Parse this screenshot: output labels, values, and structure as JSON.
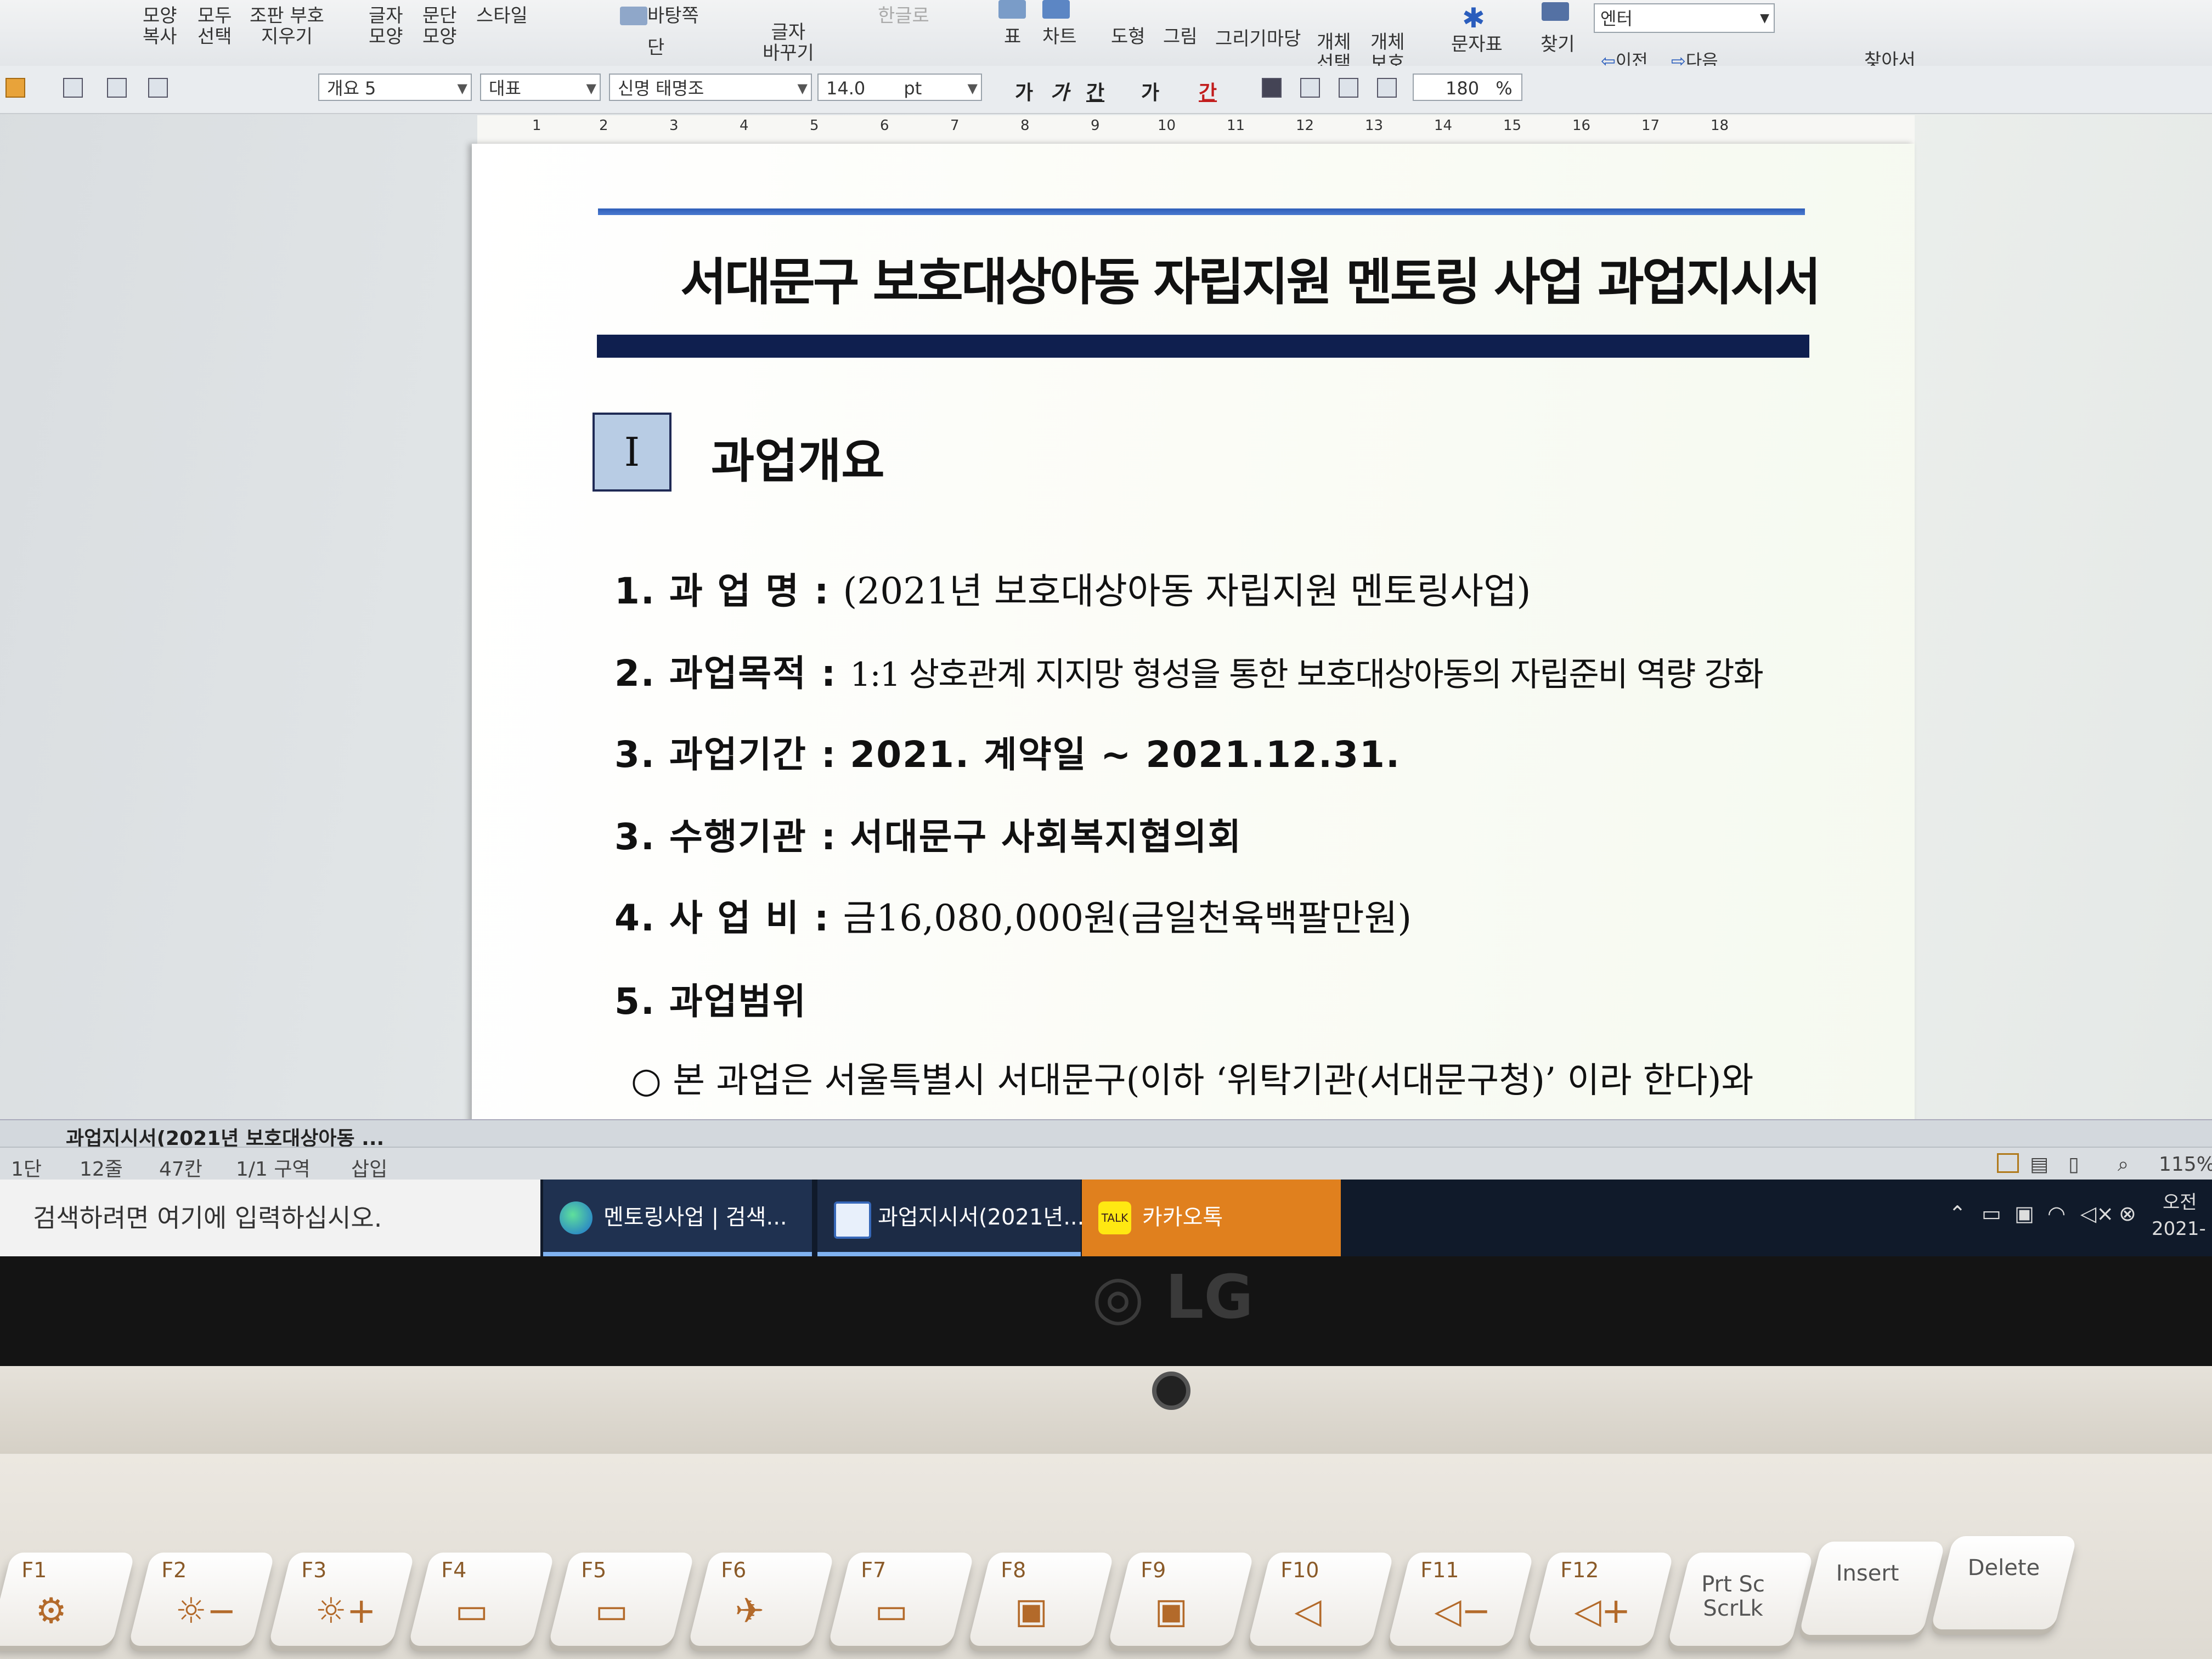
{
  "ribbon": {
    "items": [
      {
        "label": "모양\n복사"
      },
      {
        "label": "모두\n선택"
      },
      {
        "label": "조판 부호\n지우기"
      },
      {
        "label": "글자\n모양"
      },
      {
        "label": "문단\n모양"
      },
      {
        "label": "스타일"
      },
      {
        "label": "바탕쪽"
      },
      {
        "label": "단"
      },
      {
        "label": "글자\n바꾸기"
      },
      {
        "label": "한글로"
      },
      {
        "label": "표"
      },
      {
        "label": "차트"
      },
      {
        "label": "도형"
      },
      {
        "label": "그림"
      },
      {
        "label": "그리기마당"
      },
      {
        "label": "개체\n선택"
      },
      {
        "label": "개체\n보호"
      },
      {
        "label": "문자표"
      },
      {
        "label": "찾기"
      },
      {
        "label": "이전"
      },
      {
        "label": "다음"
      },
      {
        "label": "찾아서\n바꾸기"
      }
    ],
    "search_value": "엔터"
  },
  "format_bar": {
    "style": "개요 5",
    "lang": "대표",
    "font": "신명 태명조",
    "size": "14.0",
    "unit": "pt",
    "bold": "가",
    "italic": "가",
    "underline": "간",
    "strike": "가",
    "color": "간",
    "line_spacing": "180",
    "line_spacing_unit": "%"
  },
  "ruler": {
    "marks": [
      "1",
      "2",
      "3",
      "4",
      "5",
      "6",
      "7",
      "8",
      "9",
      "10",
      "11",
      "12",
      "13",
      "14",
      "15",
      "16",
      "17",
      "18"
    ]
  },
  "document": {
    "title": "서대문구 보호대상아동 자립지원 멘토링 사업 과업지시서",
    "section_num": "I",
    "section_title": "과업개요",
    "rows": [
      {
        "label": "1. 과 업 명",
        "sep": ":",
        "value": "(2021년 보호대상아동 자립지원 멘토링사업)"
      },
      {
        "label": "2. 과업목적",
        "sep": ":",
        "value": "1:1 상호관계 지지망 형성을 통한 보호대상아동의 자립준비 역량 강화"
      },
      {
        "label": "3. 과업기간",
        "sep": ":",
        "value": "2021. 계약일 ~ 2021.12.31."
      },
      {
        "label": "3. 수행기관",
        "sep": ":",
        "value": "서대문구 사회복지협의회"
      },
      {
        "label": "4. 사 업 비",
        "sep": ":",
        "value": "금16,080,000원(금일천육백팔만원)"
      },
      {
        "label": "5. 과업범위",
        "sep": "",
        "value": ""
      }
    ],
    "bullet": "○ 본 과업은 서울특별시 서대문구(이하 ‘위탁기관(서대문구청)’ 이라 한다)와"
  },
  "doc_tab": {
    "label": "과업지시서(2021년 보호대상아동 ..."
  },
  "status": {
    "col": "1단",
    "line": "12줄",
    "char": "47칸",
    "section": "1/1 구역",
    "mode": "삽입",
    "zoom": "115%"
  },
  "taskbar": {
    "search_placeholder": "검색하려면 여기에 입력하십시오.",
    "apps": [
      {
        "label": "멘토링사업 | 검색..."
      },
      {
        "label": "과업지시서(2021년..."
      },
      {
        "label": "카카오톡"
      }
    ],
    "kakao_badge": "TALK",
    "clock_top": "오전",
    "clock_bottom": "2021-"
  },
  "laptop": {
    "brand": "LG"
  },
  "keys": [
    {
      "fn": "F1",
      "sym": "⚙"
    },
    {
      "fn": "F2",
      "sym": "☼−"
    },
    {
      "fn": "F3",
      "sym": "☼+"
    },
    {
      "fn": "F4",
      "sym": "▭"
    },
    {
      "fn": "F5",
      "sym": "▭"
    },
    {
      "fn": "F6",
      "sym": "✈"
    },
    {
      "fn": "F7",
      "sym": "▭"
    },
    {
      "fn": "F8",
      "sym": "▣"
    },
    {
      "fn": "F9",
      "sym": "▣"
    },
    {
      "fn": "F10",
      "sym": "◁"
    },
    {
      "fn": "F11",
      "sym": "◁−"
    },
    {
      "fn": "F12",
      "sym": "◁+"
    }
  ],
  "special_keys": [
    {
      "label": "Prt Sc\nScrLk"
    },
    {
      "label": "Insert"
    },
    {
      "label": "Delete"
    }
  ]
}
